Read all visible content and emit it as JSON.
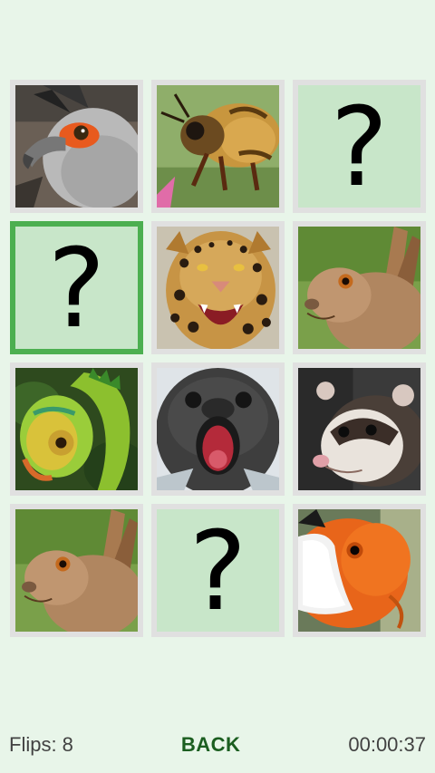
{
  "game": {
    "flips_label": "Flips: 8",
    "back_label": "BACK",
    "timer": "00:00:37",
    "hidden_symbol": "?"
  },
  "cards": [
    {
      "state": "face-up",
      "animal": "secretary-bird"
    },
    {
      "state": "face-up",
      "animal": "bee"
    },
    {
      "state": "face-down",
      "animal": ""
    },
    {
      "state": "face-down-selected",
      "animal": ""
    },
    {
      "state": "face-up",
      "animal": "jaguar"
    },
    {
      "state": "face-up",
      "animal": "hare"
    },
    {
      "state": "face-up",
      "animal": "chameleon"
    },
    {
      "state": "face-up",
      "animal": "seal"
    },
    {
      "state": "face-up",
      "animal": "ferret"
    },
    {
      "state": "face-up",
      "animal": "hare"
    },
    {
      "state": "face-down",
      "animal": ""
    },
    {
      "state": "face-up",
      "animal": "clownfish"
    }
  ],
  "colors": {
    "background": "#e8f5e9",
    "card_border": "#e0e0e0",
    "selected_border": "#4caf50",
    "card_back": "#c8e6c9",
    "back_button": "#1b5e20"
  }
}
